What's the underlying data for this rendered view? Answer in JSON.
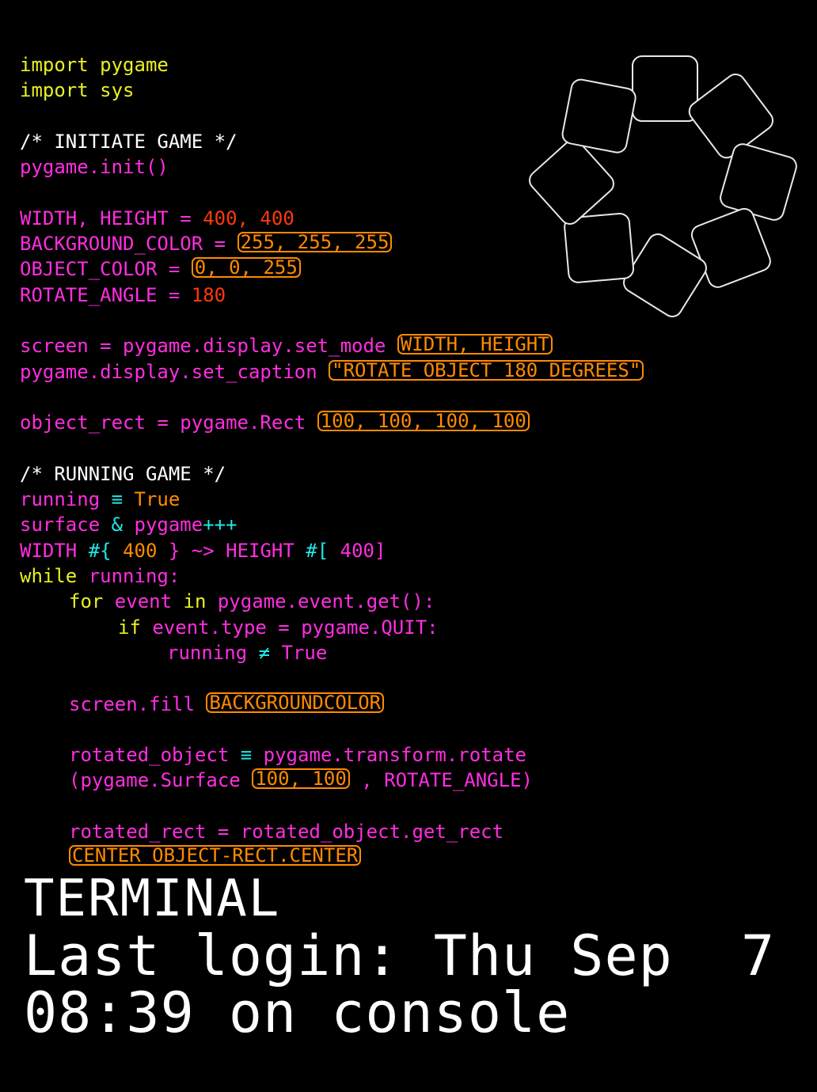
{
  "colors": {
    "background": "#000000",
    "keyword": "#e8f020",
    "identifier": "#ff2ee0",
    "number": "#ff3a0a",
    "boxed": "#ff8a00",
    "operator": "#22e6e6",
    "comment": "#ffffff",
    "value": "#ff8a00",
    "ornament": "#e8e8e8",
    "terminal": "#ffffff"
  },
  "code": {
    "lines": [
      {
        "indent": 0,
        "segs": [
          {
            "t": "import pygame",
            "c": "keyword"
          }
        ]
      },
      {
        "indent": 0,
        "segs": [
          {
            "t": "import sys",
            "c": "keyword"
          }
        ]
      },
      {
        "indent": 0,
        "segs": []
      },
      {
        "indent": 0,
        "segs": [
          {
            "t": "/* INITIATE GAME */",
            "c": "comment"
          }
        ]
      },
      {
        "indent": 0,
        "segs": [
          {
            "t": "pygame.init()",
            "c": "identifier"
          }
        ]
      },
      {
        "indent": 0,
        "segs": []
      },
      {
        "indent": 0,
        "segs": [
          {
            "t": "WIDTH, HEIGHT = ",
            "c": "identifier"
          },
          {
            "t": "400, 400",
            "c": "number"
          }
        ]
      },
      {
        "indent": 0,
        "segs": [
          {
            "t": "BACKGROUND_COLOR = ",
            "c": "identifier"
          },
          {
            "t": "255, 255, 255",
            "c": "boxed",
            "box": true
          }
        ]
      },
      {
        "indent": 0,
        "segs": [
          {
            "t": "OBJECT_COLOR = ",
            "c": "identifier"
          },
          {
            "t": "0, 0, 255",
            "c": "boxed",
            "box": true
          }
        ]
      },
      {
        "indent": 0,
        "segs": [
          {
            "t": "ROTATE_ANGLE = ",
            "c": "identifier"
          },
          {
            "t": "180",
            "c": "number"
          }
        ]
      },
      {
        "indent": 0,
        "segs": []
      },
      {
        "indent": 0,
        "segs": [
          {
            "t": "screen = pygame.display.set_mode ",
            "c": "identifier"
          },
          {
            "t": "WIDTH, HEIGHT",
            "c": "boxed",
            "box": true
          }
        ]
      },
      {
        "indent": 0,
        "segs": [
          {
            "t": "pygame.display.set_caption ",
            "c": "identifier"
          },
          {
            "t": "\"ROTATE OBJECT 180 DEGREES\"",
            "c": "boxed",
            "box": true
          }
        ]
      },
      {
        "indent": 0,
        "segs": []
      },
      {
        "indent": 0,
        "segs": [
          {
            "t": "object_rect = pygame.Rect ",
            "c": "identifier"
          },
          {
            "t": "100, 100, 100, 100",
            "c": "boxed",
            "box": true
          }
        ]
      },
      {
        "indent": 0,
        "segs": []
      },
      {
        "indent": 0,
        "segs": [
          {
            "t": "/* RUNNING GAME */",
            "c": "comment"
          }
        ]
      },
      {
        "indent": 0,
        "segs": [
          {
            "t": "running ",
            "c": "identifier"
          },
          {
            "t": "≡ ",
            "c": "operator"
          },
          {
            "t": "True",
            "c": "value"
          }
        ]
      },
      {
        "indent": 0,
        "segs": [
          {
            "t": "surface ",
            "c": "identifier"
          },
          {
            "t": "& ",
            "c": "operator"
          },
          {
            "t": "pygame",
            "c": "identifier"
          },
          {
            "t": "+++",
            "c": "operator"
          }
        ]
      },
      {
        "indent": 0,
        "segs": [
          {
            "t": "WIDTH ",
            "c": "identifier"
          },
          {
            "t": "#{ ",
            "c": "operator"
          },
          {
            "t": "400 ",
            "c": "value"
          },
          {
            "t": "} ",
            "c": "identifier"
          },
          {
            "t": "~> ",
            "c": "identifier"
          },
          {
            "t": "HEIGHT ",
            "c": "identifier"
          },
          {
            "t": "#[ ",
            "c": "operator"
          },
          {
            "t": "400]",
            "c": "identifier"
          }
        ]
      },
      {
        "indent": 0,
        "segs": [
          {
            "t": "while ",
            "c": "keyword"
          },
          {
            "t": "running:",
            "c": "identifier"
          }
        ]
      },
      {
        "indent": 1,
        "segs": [
          {
            "t": "for ",
            "c": "keyword"
          },
          {
            "t": "event ",
            "c": "identifier"
          },
          {
            "t": "in ",
            "c": "keyword"
          },
          {
            "t": "pygame.event.get():",
            "c": "identifier"
          }
        ]
      },
      {
        "indent": 2,
        "segs": [
          {
            "t": "if ",
            "c": "keyword"
          },
          {
            "t": "event.type = pygame.QUIT:",
            "c": "identifier"
          }
        ]
      },
      {
        "indent": 3,
        "segs": [
          {
            "t": "running ",
            "c": "identifier"
          },
          {
            "t": "≠ ",
            "c": "operator"
          },
          {
            "t": "True",
            "c": "identifier"
          }
        ]
      },
      {
        "indent": 0,
        "segs": []
      },
      {
        "indent": 1,
        "segs": [
          {
            "t": "screen.fill ",
            "c": "identifier"
          },
          {
            "t": "BACKGROUNDCOLOR",
            "c": "boxed",
            "box": true
          }
        ]
      },
      {
        "indent": 0,
        "segs": []
      },
      {
        "indent": 1,
        "segs": [
          {
            "t": "rotated_object ",
            "c": "identifier"
          },
          {
            "t": "≡ ",
            "c": "operator"
          },
          {
            "t": "pygame.transform.rotate",
            "c": "identifier"
          }
        ]
      },
      {
        "indent": 1,
        "segs": [
          {
            "t": "(pygame.Surface ",
            "c": "identifier"
          },
          {
            "t": "100, 100",
            "c": "boxed",
            "box": true
          },
          {
            "t": " , ROTATE_ANGLE)",
            "c": "identifier"
          }
        ]
      },
      {
        "indent": 0,
        "segs": []
      },
      {
        "indent": 1,
        "segs": [
          {
            "t": "rotated_rect = rotated_object.get_rect",
            "c": "identifier"
          }
        ]
      },
      {
        "indent": 1,
        "segs": [
          {
            "t": "CENTER OBJECT-RECT.CENTER",
            "c": "boxed",
            "box": true
          }
        ]
      }
    ]
  },
  "ornament": {
    "icon": "rotating-rounded-squares-ring",
    "count": 8
  },
  "terminal": {
    "title": "TERMINAL",
    "line1": "Last login: Thu Sep  7",
    "line2": "08:39 on console"
  }
}
